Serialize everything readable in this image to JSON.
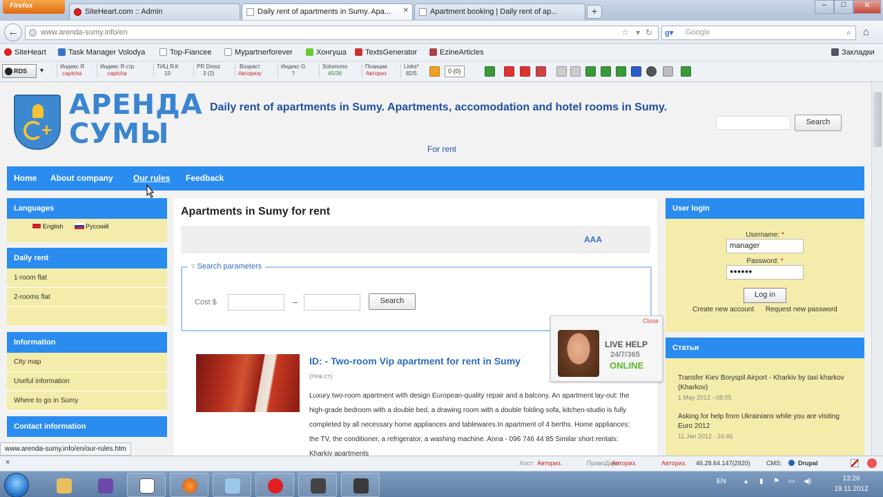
{
  "browser": {
    "app_button": "Firefox",
    "tabs": [
      {
        "title": "SiteHeart.com :: Admin"
      },
      {
        "title": "Daily rent of apartments in Sumy. Apa..."
      },
      {
        "title": "Apartment booking | Daily rent of ap..."
      }
    ],
    "new_tab": "+",
    "url": "www.arenda-sumy.info/en",
    "search_engine": "Google",
    "search_placeholder": "Google"
  },
  "bookmarks": {
    "items": [
      "SiteHeart",
      "Task Manager Volodya",
      "Top-Fiancee",
      "Mypartnerforever",
      "Хонгуша",
      "TextsGenerator",
      "EzineArticles"
    ],
    "right": "Закладки"
  },
  "seobar": {
    "rds": "RDS",
    "cells": [
      {
        "top": "Индекс Я",
        "bottom": "captcha"
      },
      {
        "top": "Индекс Я стр",
        "bottom": "captcha"
      },
      {
        "top": "ТИЦ Я.К",
        "bottom": "10"
      },
      {
        "top": "PR Dmoz",
        "bottom": "3 (2)"
      },
      {
        "top": "Возраст",
        "bottom": "Авторизу"
      },
      {
        "top": "Индекс G",
        "bottom": "?"
      },
      {
        "top": "Solomono",
        "bottom": "45/36"
      },
      {
        "top": "Позиции",
        "bottom": "Авториз"
      },
      {
        "top": "Links*",
        "bottom": "82/5"
      }
    ],
    "counter": "0 (0)"
  },
  "site": {
    "logo_line1": "АРЕНДА",
    "logo_line2": "СУМЫ",
    "title": "Daily rent of apartments in Sumy. Apartments, accomodation and hotel rooms in Sumy.",
    "slogan": "For rent",
    "search_button": "Search"
  },
  "nav": [
    "Home",
    "About company",
    "Our rules",
    "Feedback"
  ],
  "left": {
    "languages_title": "Languages",
    "languages": [
      "English",
      "Русский"
    ],
    "daily_title": "Daily rent",
    "daily_items": [
      "1-room flat",
      "2-rooms flat"
    ],
    "info_title": "Information",
    "info_items": [
      "City map",
      "Useful information",
      "Where to go in Sumy"
    ],
    "contact_title": "Contact information"
  },
  "center": {
    "title": "Apartments in Sumy for rent",
    "font_size_control": "AAA",
    "search_legend": "Search parameters",
    "cost_label": "Cost $",
    "dash": "–",
    "search_button": "Search",
    "listing": {
      "title": "ID: - Two-room Vip apartment for rent in Sumy",
      "date": "(Нов ст)",
      "text": "Luxury two-room apartment with design European-quality repair and a balcony. An apartment lay-out: the high-grade bedroom with a double bed, a drawing room with a double folding sofa, kitchen-studio is fully completed by all necessary home appliances and tablewares.In apartment of 4 berths. Home appliances: the TV, the conditioner, a refrigerator, a washing machine. Anna - 096 746 44 85 Similar short rentals: Kharkiv apartments"
    }
  },
  "right": {
    "login_title": "User login",
    "username_label": "Username:",
    "username_value": "manager",
    "password_label": "Password:",
    "password_value": "●●●●●●",
    "required_mark": "*",
    "login_button": "Log in",
    "create_account": "Create new account",
    "request_password": "Request new password",
    "articles_title": "Статьи",
    "articles": [
      {
        "title": "Transfer Kiev Boryspil Airport - Kharkiv by taxi kharkov (Kharkov)",
        "date": "1 May 2012 - 08:05"
      },
      {
        "title": "Asking for help from Ukrainians while you are visiting Euro 2012",
        "date": "11 Jan 2012 - 16:46"
      }
    ]
  },
  "livehelp": {
    "close": "Close",
    "line1": "LIVE HELP",
    "line2": "24/7/365",
    "line3": "ONLINE"
  },
  "status_url": "www.arenda-sumy.info/en/our-rules.htm",
  "statusbar": {
    "close_x": "×",
    "auth1_label": "Хост:",
    "auth1_value": "Авториз.",
    "auth2_label": "ПравоДаро:",
    "auth2_value": "Авториз.",
    "auth3": "Авториз.",
    "ip": "46.28.64.147(2920)",
    "cms_label": "CMS:",
    "cms_value": "Drupal"
  },
  "taskbar": {
    "lang": "EN",
    "time": "13:26",
    "date": "19.11.2012"
  }
}
